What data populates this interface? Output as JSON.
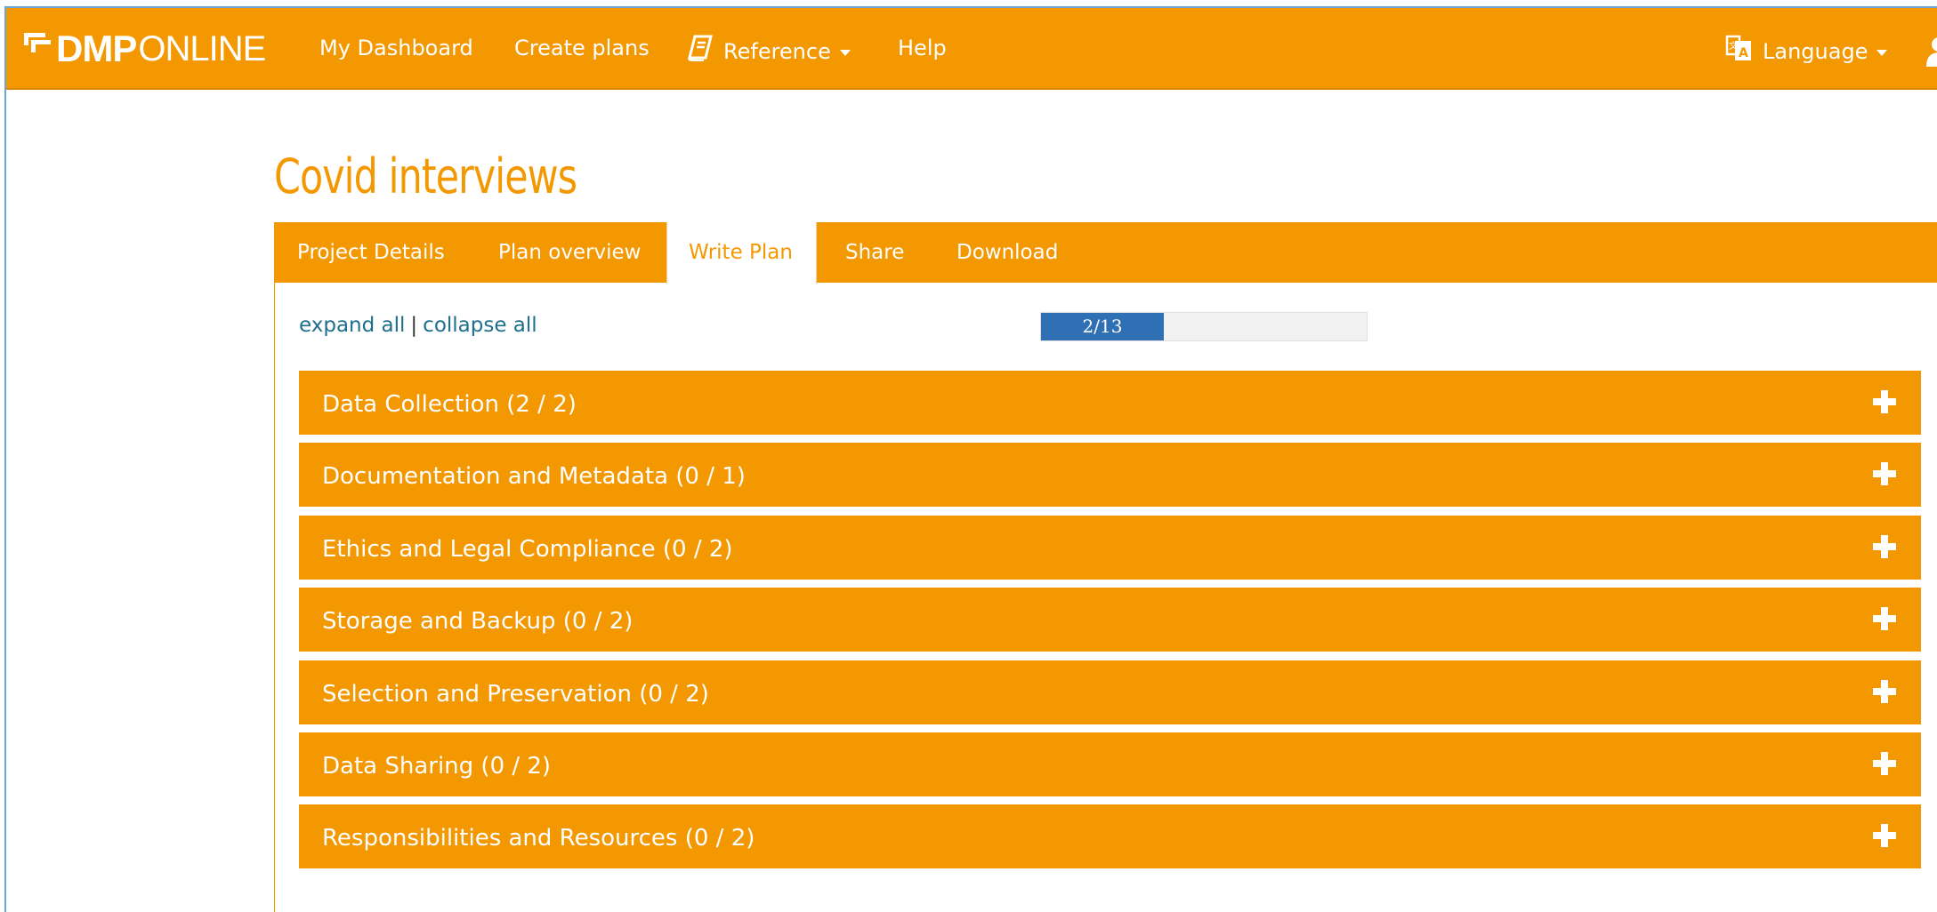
{
  "navbar": {
    "logo_bold": "DMP",
    "logo_light": "ONLINE",
    "links": [
      {
        "label": "My Dashboard"
      },
      {
        "label": "Create plans"
      },
      {
        "label": "Reference"
      },
      {
        "label": "Help"
      }
    ],
    "language_label": "Language"
  },
  "page": {
    "title": "Covid interviews"
  },
  "tabs": [
    {
      "label": "Project Details"
    },
    {
      "label": "Plan overview"
    },
    {
      "label": "Write Plan",
      "active": true
    },
    {
      "label": "Share"
    },
    {
      "label": "Download"
    }
  ],
  "controls": {
    "expand_all": "expand all",
    "separator": "|",
    "collapse_all": "collapse all"
  },
  "progress": {
    "label": "2/13",
    "answered": 2,
    "total": 13
  },
  "sections": [
    {
      "title": "Data Collection (2 / 2)"
    },
    {
      "title": "Documentation and Metadata (0 / 1)"
    },
    {
      "title": "Ethics and Legal Compliance (0 / 2)"
    },
    {
      "title": "Storage and Backup (0 / 2)"
    },
    {
      "title": "Selection and Preservation (0 / 2)"
    },
    {
      "title": "Data Sharing (0 / 2)"
    },
    {
      "title": "Responsibilities and Resources (0 / 2)"
    }
  ],
  "colors": {
    "brand_orange": "#f39800",
    "progress_blue": "#2f6fb4",
    "link_teal": "#1d6f8c"
  }
}
